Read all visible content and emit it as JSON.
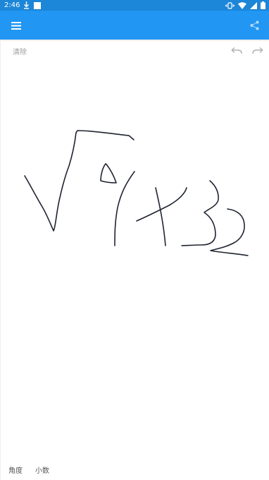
{
  "status_bar": {
    "time": "2:46",
    "icons": [
      "download-icon",
      "notification-square-icon",
      "vibrate-icon",
      "wifi-icon",
      "signal-icon",
      "battery-icon"
    ]
  },
  "app_bar": {
    "color": "#2196F3",
    "menu_icon": "menu-icon",
    "share_icon": "share-icon"
  },
  "toolbar": {
    "clear_label": "清除",
    "undo_icon": "undo-icon",
    "redo_icon": "redo-icon"
  },
  "canvas": {
    "stroke_color": "#1f2430"
  },
  "bottom_bar": {
    "angle_label": "角度",
    "decimal_label": "小数"
  }
}
